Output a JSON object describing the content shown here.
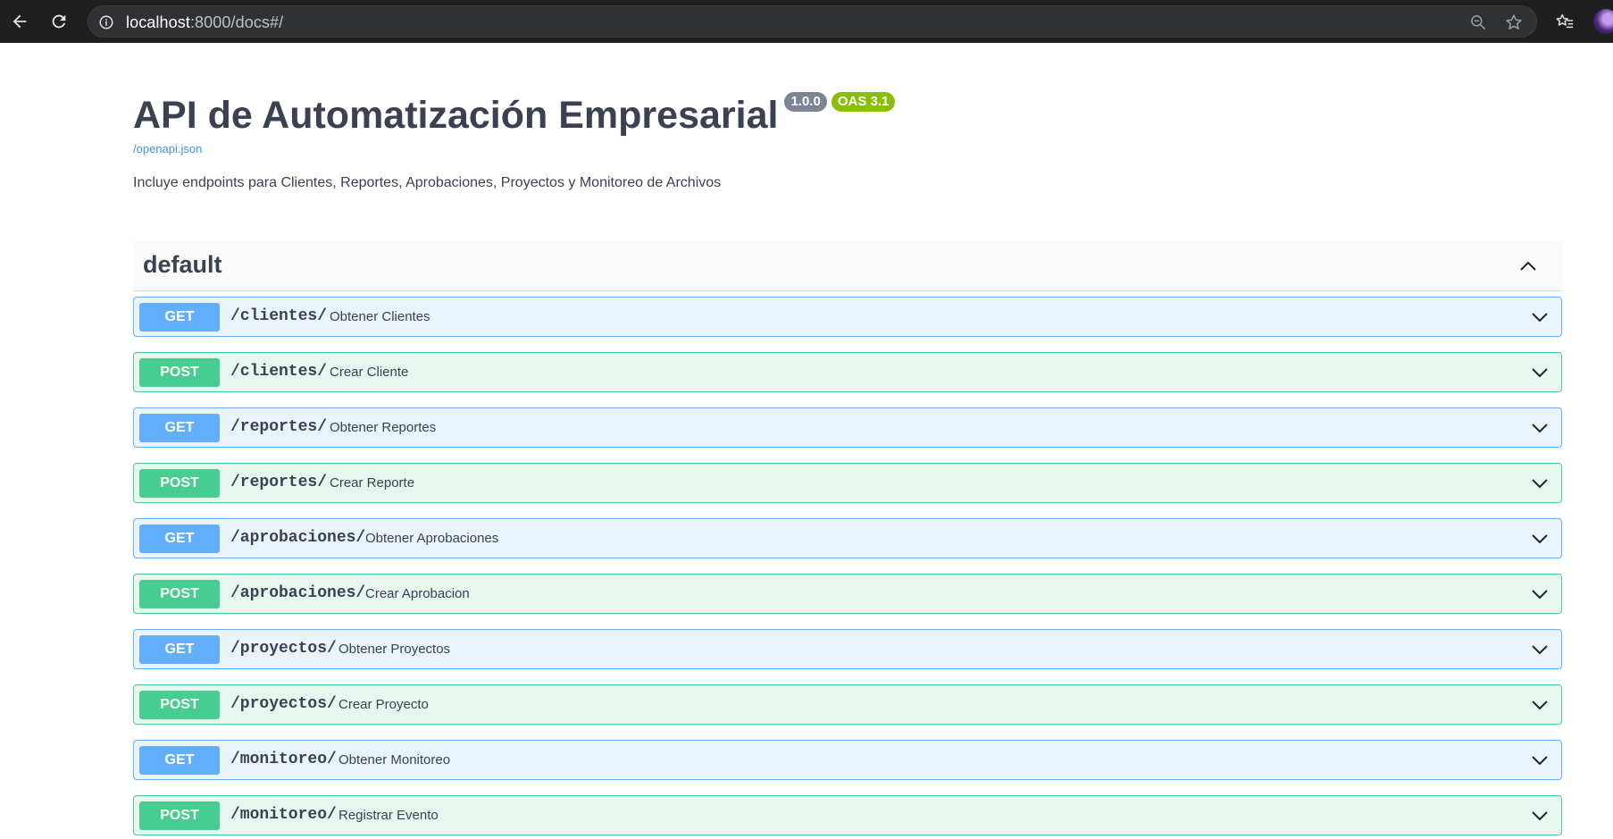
{
  "browser": {
    "url_host": "localhost",
    "url_rest": ":8000/docs#/"
  },
  "info": {
    "title": "API de Automatización Empresarial",
    "version_badge": "1.0.0",
    "oas_badge": "OAS 3.1",
    "openapi_link": "/openapi.json",
    "description": "Incluye endpoints para Clientes, Reportes, Aprobaciones, Proyectos y Monitoreo de Archivos"
  },
  "section": {
    "title": "default"
  },
  "operations": [
    {
      "method": "GET",
      "path": "/clientes/",
      "summary": "Obtener Clientes"
    },
    {
      "method": "POST",
      "path": "/clientes/",
      "summary": "Crear Cliente"
    },
    {
      "method": "GET",
      "path": "/reportes/",
      "summary": "Obtener Reportes"
    },
    {
      "method": "POST",
      "path": "/reportes/",
      "summary": "Crear Reporte"
    },
    {
      "method": "GET",
      "path": "/aprobaciones/",
      "summary": "Obtener Aprobaciones"
    },
    {
      "method": "POST",
      "path": "/aprobaciones/",
      "summary": "Crear Aprobacion"
    },
    {
      "method": "GET",
      "path": "/proyectos/",
      "summary": "Obtener Proyectos"
    },
    {
      "method": "POST",
      "path": "/proyectos/",
      "summary": "Crear Proyecto"
    },
    {
      "method": "GET",
      "path": "/monitoreo/",
      "summary": "Obtener Monitoreo"
    },
    {
      "method": "POST",
      "path": "/monitoreo/",
      "summary": "Registrar Evento"
    }
  ],
  "colors": {
    "get": "#61affe",
    "post": "#49cc90",
    "badge_version": "#7d8492",
    "badge_oas": "#89bf04",
    "link": "#4990e2"
  }
}
